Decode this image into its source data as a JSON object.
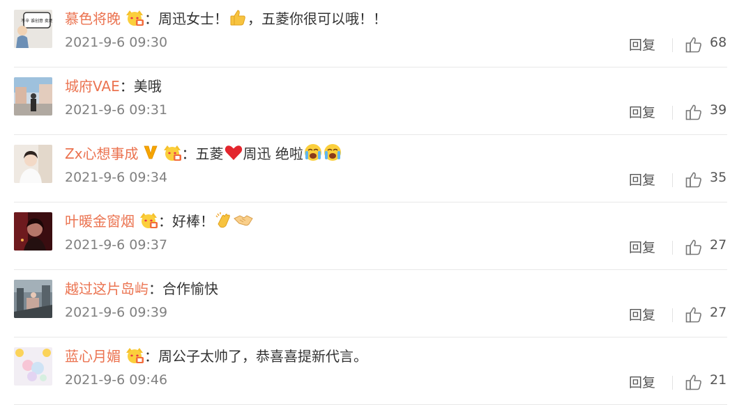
{
  "comments": [
    {
      "username": "慕色将晚",
      "colon": "：",
      "text_before": "周迅女士！",
      "text_after": "，五菱你很可以哦！！",
      "emoji_1": "thumbs-up-icon",
      "time": "2021-9-6 09:30",
      "reply_label": "回复",
      "likes": "68",
      "avatar_bubble_text": "不辛 谁创意 卖场",
      "avatar": "cartoon-avatar"
    },
    {
      "username": "城府VAE",
      "colon": "：",
      "text_before": "美哦",
      "time": "2021-9-6 09:31",
      "reply_label": "回复",
      "likes": "39",
      "avatar": "street-photo-avatar"
    },
    {
      "username": "Zx心想事成",
      "colon": "：",
      "text_before": "五菱",
      "text_middle": "周迅 绝啦",
      "emoji_1": "red-heart-icon",
      "emoji_2": "crying-face-icon",
      "time": "2021-9-6 09:34",
      "reply_label": "回复",
      "likes": "35",
      "avatar": "portrait-avatar"
    },
    {
      "username": "叶暖金窗烟",
      "colon": "：",
      "text_before": "好棒！",
      "emoji_1": "clapping-hands-icon",
      "emoji_2": "handshake-icon",
      "time": "2021-9-6 09:37",
      "reply_label": "回复",
      "likes": "27",
      "avatar": "dark-portrait-avatar"
    },
    {
      "username": "越过这片岛屿",
      "colon": "：",
      "text_before": "合作愉快",
      "time": "2021-9-6 09:39",
      "reply_label": "回复",
      "likes": "27",
      "avatar": "city-photo-avatar"
    },
    {
      "username": "蓝心月媚",
      "colon": "：",
      "text_before": "周公子太帅了，恭喜喜提新代言。",
      "time": "2021-9-6 09:46",
      "reply_label": "回复",
      "likes": "21",
      "avatar": "pastel-avatar"
    }
  ],
  "colors": {
    "username": "#eb7350",
    "text": "#333333",
    "meta": "#808080",
    "divider": "#e8e8e8"
  }
}
